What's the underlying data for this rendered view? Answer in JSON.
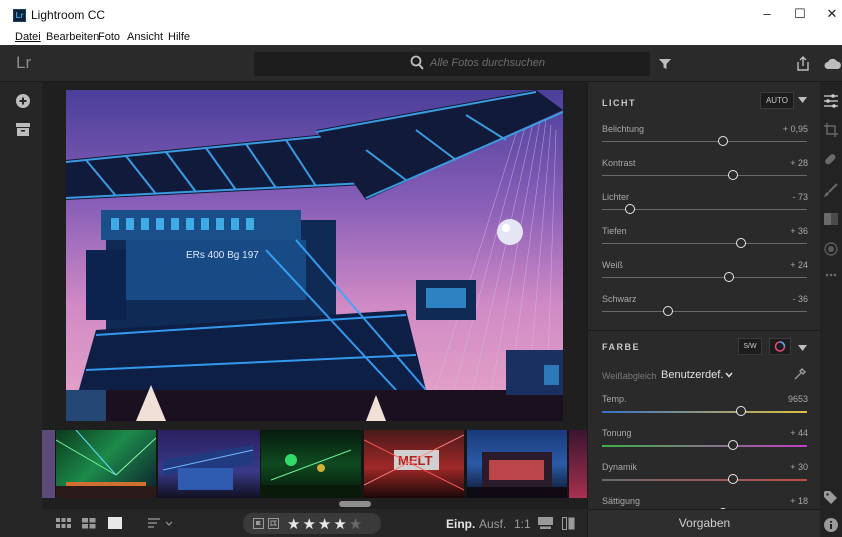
{
  "window": {
    "app_title": "Lightroom CC",
    "logo_text": "Lr"
  },
  "menu": {
    "items": [
      "Datei",
      "Bearbeiten",
      "Foto",
      "Ansicht",
      "Hilfe"
    ]
  },
  "topbar": {
    "brand": "Lr",
    "search_placeholder": "Alle Fotos durchsuchen"
  },
  "panel": {
    "light": {
      "title": "LICHT",
      "auto_label": "AUTO",
      "sliders": [
        {
          "label": "Belichtung",
          "value": "+ 0,95",
          "level": 0.59
        },
        {
          "label": "Kontrast",
          "value": "+ 28",
          "level": 0.64
        },
        {
          "label": "Lichter",
          "value": "- 73",
          "level": 0.135
        },
        {
          "label": "Tiefen",
          "value": "+ 36",
          "level": 0.68
        },
        {
          "label": "Weiß",
          "value": "+ 24",
          "level": 0.62
        },
        {
          "label": "Schwarz",
          "value": "- 36",
          "level": 0.32
        }
      ]
    },
    "color": {
      "title": "FARBE",
      "sw_label": "S/W",
      "wb_label": "Weißabgleich",
      "wb_value": "Benutzerdef.",
      "sliders": [
        {
          "label": "Temp.",
          "value": "9653",
          "level": 0.68
        },
        {
          "label": "Tonung",
          "value": "+ 44",
          "level": 0.64
        },
        {
          "label": "Dynamik",
          "value": "+ 30",
          "level": 0.64
        },
        {
          "label": "Sättigung",
          "value": "+ 18",
          "level": 0.59
        }
      ]
    },
    "presets_label": "Vorgaben"
  },
  "photo": {
    "sign_text": "ERs 400  Bg 197"
  },
  "filmstrip": {
    "sign_text": "MELT"
  },
  "bottombar": {
    "rating": 4,
    "max_rating": 5,
    "fit_label": "Einp.",
    "fill_label": "Ausf.",
    "ratio_label": "1:1"
  },
  "colors": {
    "accent": "#34a3e6",
    "background": "#1e1e1e",
    "panel": "#2a2a2a"
  }
}
